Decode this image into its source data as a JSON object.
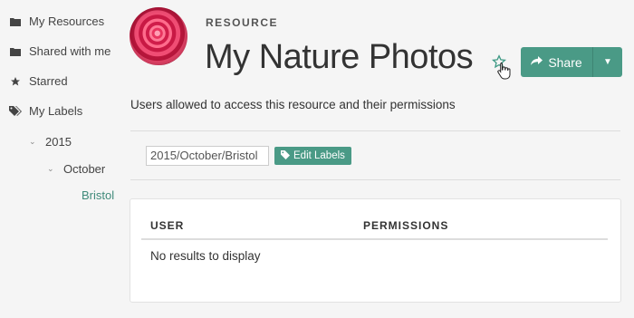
{
  "sidebar": {
    "items": [
      {
        "label": "My Resources",
        "icon": "folder-icon"
      },
      {
        "label": "Shared with me",
        "icon": "folder-icon"
      },
      {
        "label": "Starred",
        "icon": "star-icon"
      },
      {
        "label": "My Labels",
        "icon": "tags-icon"
      }
    ],
    "tree": [
      {
        "label": "2015",
        "expanded": true
      },
      {
        "label": "October",
        "expanded": true
      },
      {
        "label": "Bristol",
        "selected": true
      }
    ]
  },
  "header": {
    "eyebrow": "RESOURCE",
    "title": "My Nature Photos",
    "share_label": "Share"
  },
  "description": "Users allowed to access this resource and their permissions",
  "labels": {
    "current_value": "2015/October/Bristol",
    "edit_label": "Edit Labels"
  },
  "permissions_table": {
    "columns": [
      "USER",
      "PERMISSIONS"
    ],
    "empty_text": "No results to display"
  },
  "colors": {
    "accent": "#4a9a86",
    "active_link": "#3f8a7a"
  }
}
